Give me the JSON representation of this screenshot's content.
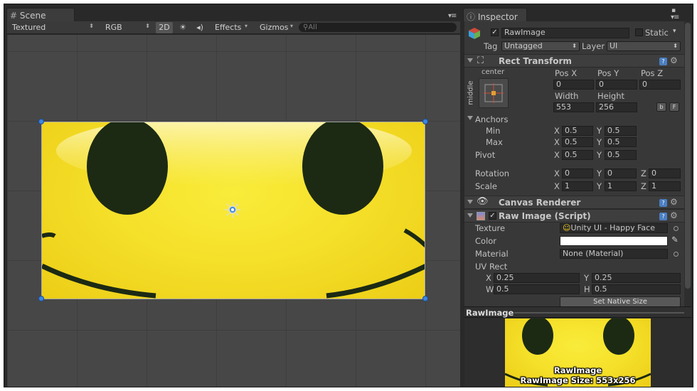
{
  "scene": {
    "tab_label": "Scene",
    "shading_mode": "Textured",
    "render_mode": "RGB",
    "mode_2d": "2D",
    "effects_label": "Effects",
    "gizmos_label": "Gizmos",
    "search_placeholder": "All"
  },
  "inspector": {
    "tab_label": "Inspector",
    "object_name": "RawImage",
    "static_label": "Static",
    "tag_label": "Tag",
    "tag_value": "Untagged",
    "layer_label": "Layer",
    "layer_value": "UI"
  },
  "rect_transform": {
    "title": "Rect Transform",
    "anchor_preset_top": "center",
    "anchor_preset_side": "middle",
    "pos_x_label": "Pos X",
    "pos_y_label": "Pos Y",
    "pos_z_label": "Pos Z",
    "pos_x": "0",
    "pos_y": "0",
    "pos_z": "0",
    "width_label": "Width",
    "height_label": "Height",
    "width": "553",
    "height": "256",
    "blueprint_btn": "b",
    "raw_btn": "F",
    "anchors_label": "Anchors",
    "min_label": "Min",
    "max_label": "Max",
    "x_label": "X",
    "y_label": "Y",
    "z_label": "Z",
    "anchor_min_x": "0.5",
    "anchor_min_y": "0.5",
    "anchor_max_x": "0.5",
    "anchor_max_y": "0.5",
    "pivot_label": "Pivot",
    "pivot_x": "0.5",
    "pivot_y": "0.5",
    "rotation_label": "Rotation",
    "rot_x": "0",
    "rot_y": "0",
    "rot_z": "0",
    "scale_label": "Scale",
    "scale_x": "1",
    "scale_y": "1",
    "scale_z": "1"
  },
  "canvas_renderer": {
    "title": "Canvas Renderer"
  },
  "raw_image": {
    "title": "Raw Image (Script)",
    "texture_label": "Texture",
    "texture_value": "Unity UI - Happy Face",
    "color_label": "Color",
    "color_value": "#ffffff",
    "material_label": "Material",
    "material_value": "None (Material)",
    "uv_rect_label": "UV Rect",
    "x_label": "X",
    "y_label": "Y",
    "w_label": "W",
    "h_label": "H",
    "uv_x": "0.25",
    "uv_y": "0.25",
    "uv_w": "0.5",
    "uv_h": "0.5",
    "native_size_btn": "Set Native Size"
  },
  "preview": {
    "header": "RawImage",
    "line1": "RawImage",
    "line2": "RawImage Size: 553x256"
  },
  "colors": {
    "handle": "#3a86e0",
    "face_yellow": "#f5e02a",
    "feature_dark": "#1c2a14"
  }
}
